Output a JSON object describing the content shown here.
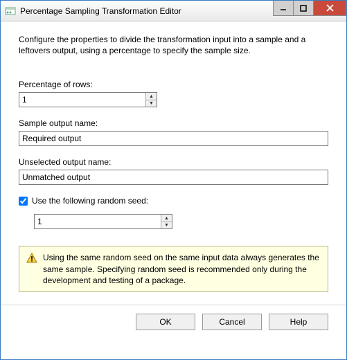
{
  "window": {
    "title": "Percentage Sampling Transformation Editor"
  },
  "description": "Configure the properties to divide the transformation input into a sample and a leftovers output, using a percentage to specify the sample size.",
  "fields": {
    "percentage_label": "Percentage of rows:",
    "percentage_value": "1",
    "sample_output_label": "Sample output name:",
    "sample_output_value": "Required output",
    "unselected_output_label": "Unselected output name:",
    "unselected_output_value": "Unmatched output",
    "seed_checkbox_label": "Use the following random seed:",
    "seed_checked": true,
    "seed_value": "1"
  },
  "info": "Using the same random seed on the same input data always generates the same sample. Specifying random seed is recommended only during the development and testing of a package.",
  "buttons": {
    "ok": "OK",
    "cancel": "Cancel",
    "help": "Help"
  }
}
